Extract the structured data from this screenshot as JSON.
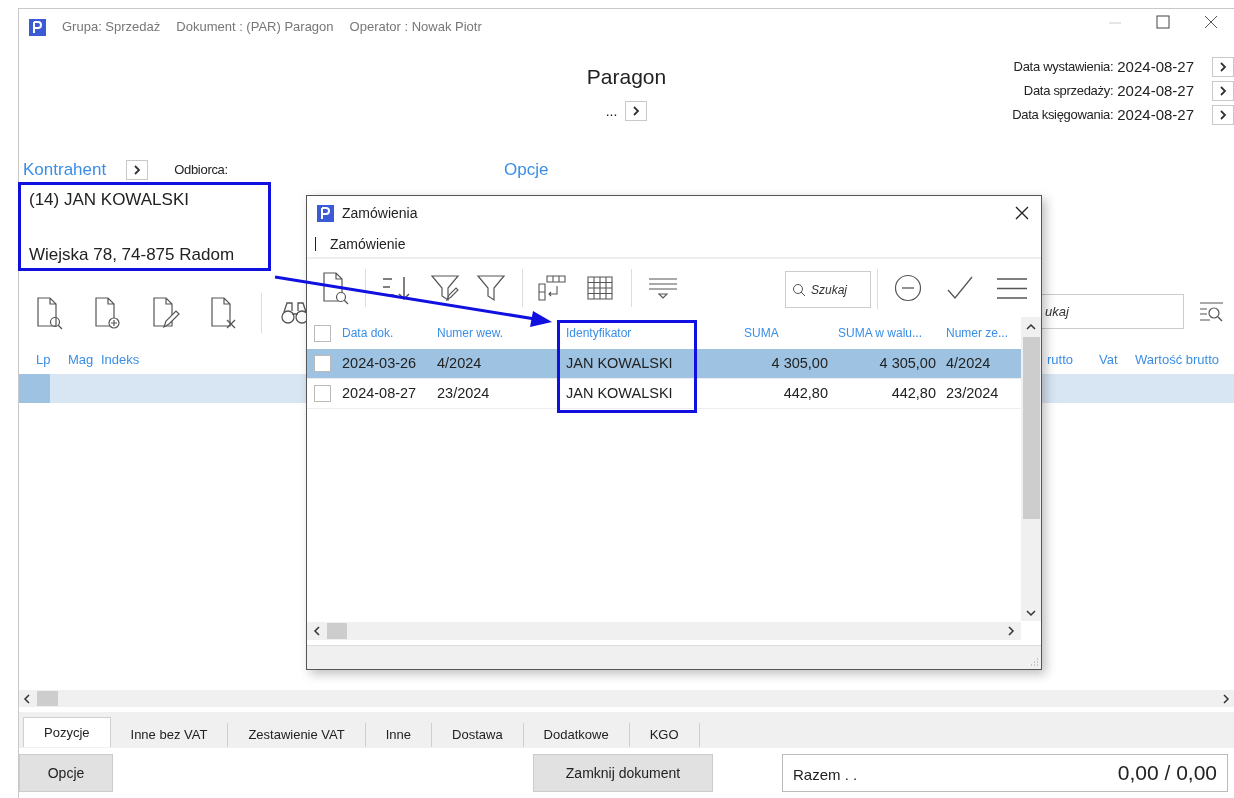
{
  "window": {
    "title_parts": [
      "Grupa: Sprzedaż",
      "Dokument : (PAR) Paragon",
      "Operator : Nowak Piotr"
    ]
  },
  "document": {
    "title": "Paragon",
    "number": "...",
    "dates": [
      {
        "label": "Data wystawienia:",
        "value": "2024-08-27"
      },
      {
        "label": "Data sprzedaży:",
        "value": "2024-08-27"
      },
      {
        "label": "Data księgowania:",
        "value": "2024-08-27"
      }
    ]
  },
  "contractor": {
    "heading": "Kontrahent",
    "recipient_label": "Odbiorca:",
    "name": "(14) JAN KOWALSKI",
    "address": "Wiejska 78, 74-875 Radom"
  },
  "options": {
    "heading": "Opcje"
  },
  "items": {
    "search_placeholder": "ukaj",
    "columns": [
      "Lp",
      "Mag",
      "Indeks",
      "rutto",
      "Vat",
      "Wartość brutto"
    ]
  },
  "tabs": [
    {
      "label": "Pozycje",
      "selected": true
    },
    {
      "label": "Inne bez VAT",
      "selected": false
    },
    {
      "label": "Zestawienie VAT",
      "selected": false
    },
    {
      "label": "Inne",
      "selected": false
    },
    {
      "label": "Dostawa",
      "selected": false
    },
    {
      "label": "Dodatkowe",
      "selected": false
    },
    {
      "label": "KGO",
      "selected": false
    }
  ],
  "footer": {
    "options_button": "Opcje",
    "close_button": "Zamknij dokument",
    "total_label": "Razem . .",
    "total_value": "0,00 / 0,00"
  },
  "dialog": {
    "title": "Zamówienia",
    "all_checked": false,
    "menu": [
      "Zamówienie"
    ],
    "search_placeholder": "Szukaj",
    "columns": [
      "Data dok.",
      "Numer wew.",
      "Identyfikator",
      "SUMA",
      "SUMA w walu...",
      "Numer ze..."
    ],
    "rows": [
      {
        "checked": false,
        "selected": true,
        "cells": [
          "2024-03-26",
          "4/2024",
          "JAN KOWALSKI",
          "4 305,00",
          "4 305,00",
          "4/2024"
        ]
      },
      {
        "checked": false,
        "selected": false,
        "cells": [
          "2024-08-27",
          "23/2024",
          "JAN KOWALSKI",
          "442,80",
          "442,80",
          "23/2024"
        ]
      }
    ]
  }
}
